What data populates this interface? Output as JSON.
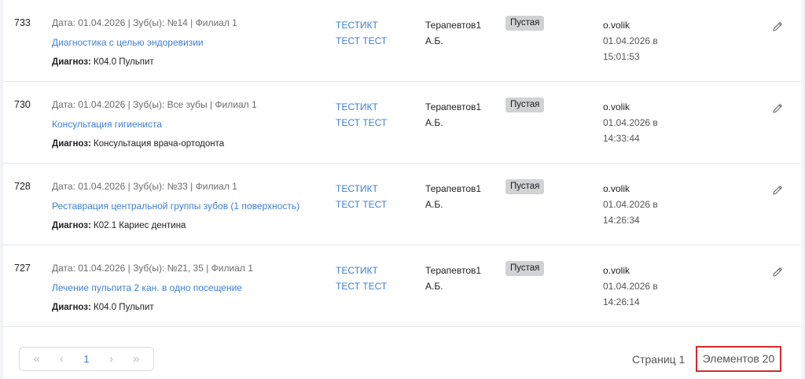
{
  "rows": [
    {
      "id": "733",
      "meta": "Дата: 01.04.2026 | Зуб(ы): №14 | Филиал 1",
      "service": "Диагностика с целью эндоревизии",
      "diagnosis_label": "Диагноз:",
      "diagnosis": "К04.0 Пульпит",
      "patient_line1": "ТЕСТИКТ",
      "patient_line2": "ТЕСТ ТЕСТ",
      "doctor_line1": "Терапевтов1",
      "doctor_line2": "А.Б.",
      "status": "Пустая",
      "author": "o.volik",
      "date_line1": "01.04.2026 в",
      "date_line2": "15:01:53"
    },
    {
      "id": "730",
      "meta": "Дата: 01.04.2026 | Зуб(ы): Все зубы | Филиал 1",
      "service": "Консультация гигиениста",
      "diagnosis_label": "Диагноз:",
      "diagnosis": "Консультация врача-ортодонта",
      "patient_line1": "ТЕСТИКТ",
      "patient_line2": "ТЕСТ ТЕСТ",
      "doctor_line1": "Терапевтов1",
      "doctor_line2": "А.Б.",
      "status": "Пустая",
      "author": "o.volik",
      "date_line1": "01.04.2026 в",
      "date_line2": "14:33:44"
    },
    {
      "id": "728",
      "meta": "Дата: 01.04.2026 | Зуб(ы): №33 | Филиал 1",
      "service": "Реставрация центральной группы зубов (1 поверхность)",
      "diagnosis_label": "Диагноз:",
      "diagnosis": "К02.1 Кариес дентина",
      "patient_line1": "ТЕСТИКТ",
      "patient_line2": "ТЕСТ ТЕСТ",
      "doctor_line1": "Терапевтов1",
      "doctor_line2": "А.Б.",
      "status": "Пустая",
      "author": "o.volik",
      "date_line1": "01.04.2026 в",
      "date_line2": "14:26:34"
    },
    {
      "id": "727",
      "meta": "Дата: 01.04.2026 | Зуб(ы): №21, 35 | Филиал 1",
      "service": "Лечение пульпита 2 кан. в одно посещение",
      "diagnosis_label": "Диагноз:",
      "diagnosis": "К04.0 Пульпит",
      "patient_line1": "ТЕСТИКТ",
      "patient_line2": "ТЕСТ ТЕСТ",
      "doctor_line1": "Терапевтов1",
      "doctor_line2": "А.Б.",
      "status": "Пустая",
      "author": "o.volik",
      "date_line1": "01.04.2026 в",
      "date_line2": "14:26:14"
    }
  ],
  "pagination": {
    "first": "«",
    "prev": "‹",
    "current_page": "1",
    "next": "›",
    "last": "»",
    "pages_label": "Страниц 1",
    "elements_label": "Элементов 20"
  },
  "colors": {
    "link": "#3f7fd4",
    "status_badge_bg": "#d0d2d6",
    "highlight_border": "#d42a2a"
  },
  "icons": {
    "row_action": "pencil-edit-icon"
  }
}
